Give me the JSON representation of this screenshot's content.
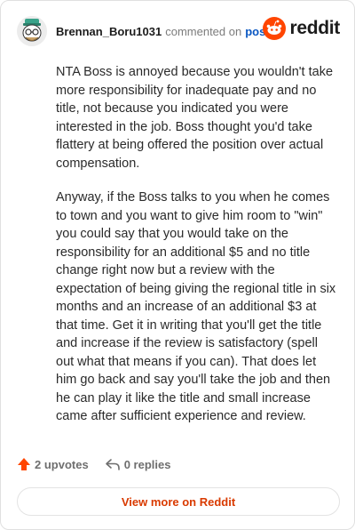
{
  "comment": {
    "username": "Brennan_Boru1031",
    "action_text": "commented on",
    "post_link": "post",
    "paragraphs": [
      "NTA Boss is annoyed because you wouldn't take more responsibility for inadequate pay and no title, not because you indicated you were interested in the job. Boss thought you'd take flattery at being offered the position over actual compensation.",
      "Anyway, if the Boss talks to you when he comes to town and you want to give him room to \"win\" you could say that you would take on the responsibility for an additional $5 and no title change right now but a review with the expectation of being giving the regional title in six months and an increase of an additional $3 at that time. Get it in writing that you'll get the title and increase if the review is satisfactory (spell out what that means if you can). That does let him go back and say you'll take the job and then he can play it like the title and small increase came after sufficient experience and review."
    ]
  },
  "brand": {
    "wordmark": "reddit",
    "accent": "#ff4500"
  },
  "actions": {
    "upvotes_label": "2 upvotes",
    "replies_label": "0 replies"
  },
  "footer": {
    "view_more_label": "View more on Reddit"
  },
  "colors": {
    "link": "#0a57c2",
    "cta": "#d93a00",
    "upvote": "#ff4500"
  }
}
